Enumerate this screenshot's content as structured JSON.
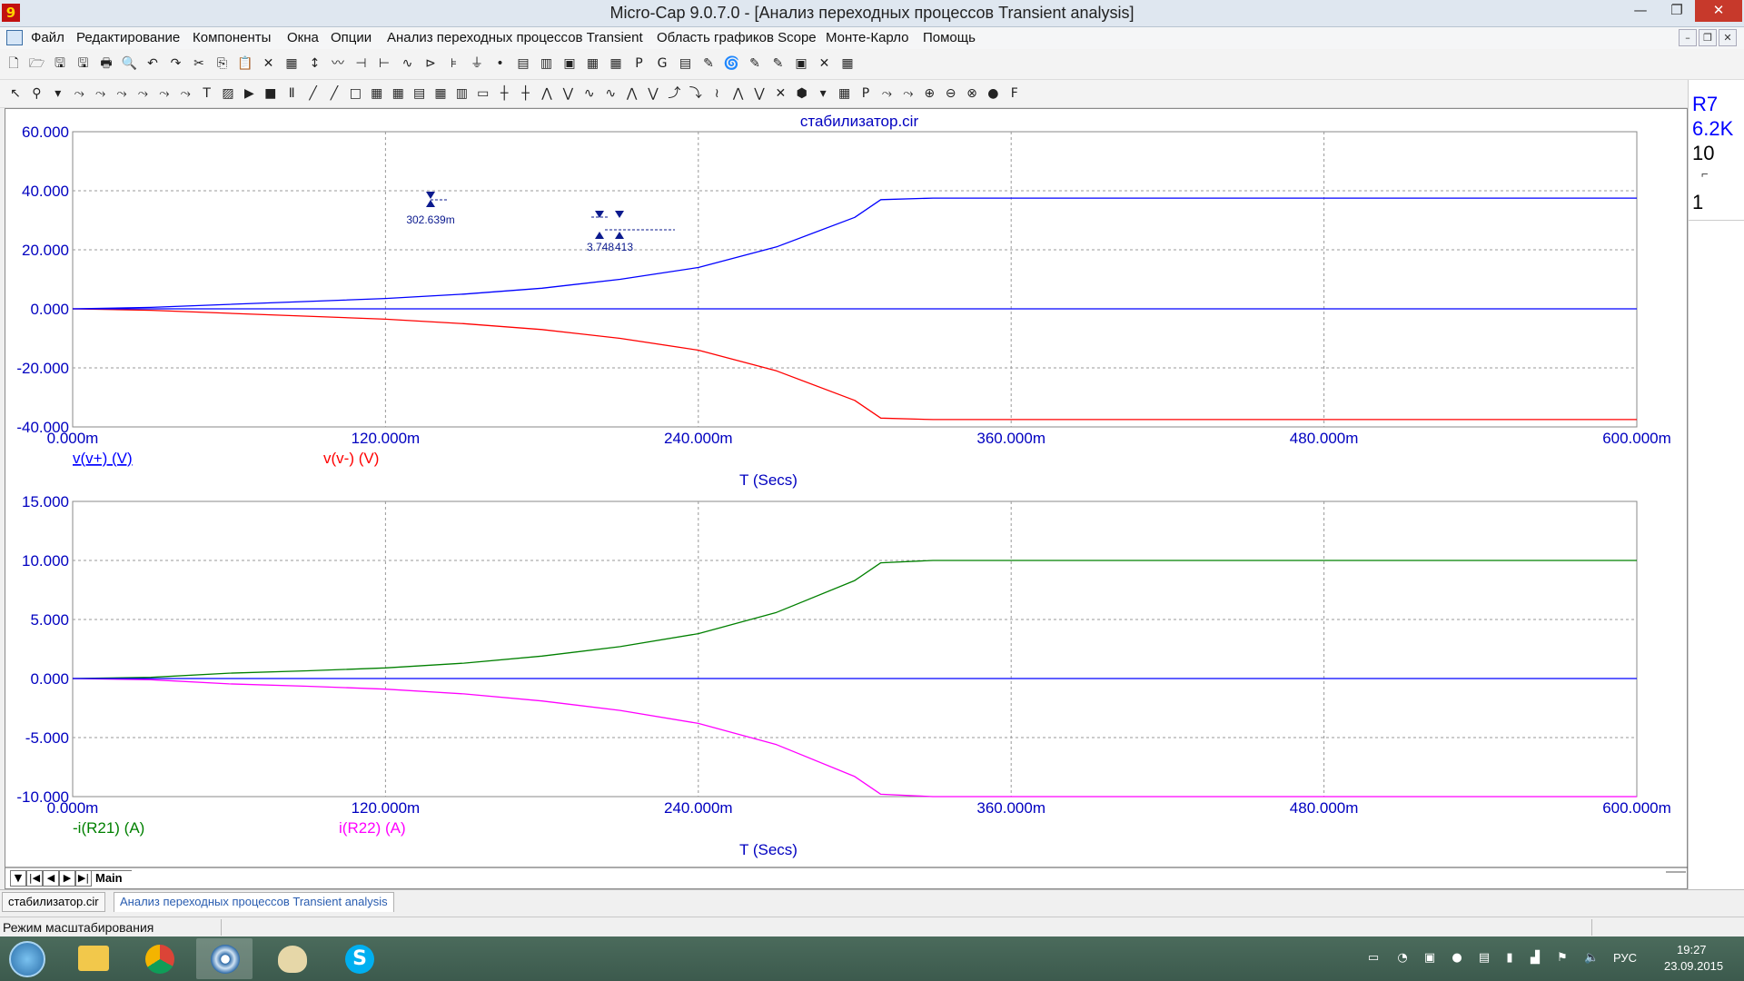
{
  "window": {
    "app_icon": "9",
    "title": "Micro-Cap 9.0.7.0 - [Анализ переходных процессов Transient analysis]",
    "minimize": "—",
    "maximize": "❐",
    "close": "✕"
  },
  "menu": {
    "items": [
      "Файл",
      "Редактирование",
      "Компоненты",
      "Окна",
      "Опции",
      "Анализ переходных процессов Transient",
      "Область графиков Scope",
      "Монте-Карло",
      "Помощь"
    ],
    "mdi_minimize": "–",
    "mdi_restore": "❐",
    "mdi_close": "✕"
  },
  "toolbar1": {
    "icons": [
      "new-icon",
      "open-icon",
      "save-icon",
      "save-all-icon",
      "print-icon",
      "print-preview-icon",
      "undo-icon",
      "redo-icon",
      "cut-icon",
      "copy-icon",
      "paste-icon",
      "delete-icon",
      "select-all-icon",
      "wire-icon",
      "diagonal-wire-icon",
      "resistor-icon",
      "capacitor-icon",
      "inductor-icon",
      "diode-icon",
      "battery-icon",
      "ground-icon",
      "node-icon",
      "tile-horizontal-icon",
      "tile-vertical-icon",
      "cascade-icon",
      "arrange-icon",
      "calculator-icon",
      "probe-p-icon",
      "probe-g-icon",
      "table-icon",
      "mark-icon",
      "scope-icon",
      "marker-icon",
      "pen-icon",
      "watch-icon",
      "x-icon",
      "grid-icon"
    ],
    "glyphs": [
      "🗋",
      "🗁",
      "🖫",
      "🖫",
      "🖶",
      "🔍",
      "↶",
      "↷",
      "✂",
      "⎘",
      "📋",
      "✕",
      "▦",
      "↕",
      "〰",
      "⊣",
      "⊢",
      "∿",
      "⊳",
      "⊧",
      "⏚",
      "•",
      "▤",
      "▥",
      "▣",
      "▦",
      "▦",
      "P",
      "G",
      "▤",
      "✎",
      "🌀",
      "✎",
      "✎",
      "▣",
      "✕",
      "▦"
    ]
  },
  "toolbar2": {
    "icons": [
      "select-arrow-icon",
      "zoom-icon",
      "dropdown-icon",
      "graph-icon",
      "graph2-icon",
      "graph3-icon",
      "graph4-icon",
      "graph5-icon",
      "graph6-icon",
      "text-icon",
      "properties-icon",
      "run-icon",
      "stop-icon",
      "pause-icon",
      "line-icon",
      "diagonal-icon",
      "box-icon",
      "grid-icon",
      "grid2-icon",
      "grid3-icon",
      "grid4-icon",
      "grid5-icon",
      "legend-icon",
      "cursor-icon",
      "cursor2-icon",
      "cursor3-icon",
      "scope-icon",
      "cursor-next-icon",
      "cursor-prev-icon",
      "peak-icon",
      "valley-icon",
      "high-icon",
      "low-icon",
      "inflection-icon",
      "top-icon",
      "bottom-icon",
      "slope-icon",
      "data-icon",
      "dropdown2-icon",
      "table-icon",
      "p-icon",
      "tag-icon",
      "tag2-icon",
      "zoom-in-icon",
      "zoom-out-icon",
      "zoom-fit-icon",
      "color-icon",
      "font-icon"
    ],
    "glyphs": [
      "↖",
      "⚲",
      "▾",
      "⤳",
      "⤳",
      "⤳",
      "⤳",
      "⤳",
      "⤳",
      "T",
      "▨",
      "▶",
      "■",
      "Ⅱ",
      "╱",
      "╱",
      "□",
      "▦",
      "▦",
      "▤",
      "▦",
      "▥",
      "▭",
      "┼",
      "┼",
      "⋀",
      "⋁",
      "∿",
      "∿",
      "⋀",
      "⋁",
      "⤴",
      "⤵",
      "≀",
      "⋀",
      "⋁",
      "✕",
      "⬢",
      "▾",
      "▦",
      "P",
      "⤳",
      "⤳",
      "⊕",
      "⊖",
      "⊗",
      "●",
      "F"
    ]
  },
  "side_panel": {
    "lines": [
      "R7",
      "6.2K",
      "10",
      "⌐",
      "1"
    ]
  },
  "plot": {
    "title": "стабилизатор.cir",
    "marker1": "302.639m",
    "marker2a": "3.748",
    "marker2b": "413",
    "colors": {
      "blue": "#0000ff",
      "red": "#ff0000",
      "green": "#008000",
      "magenta": "#ff00ff",
      "axis_text": "#0000c0"
    }
  },
  "chart_data": [
    {
      "type": "line",
      "xlabel": "T (Secs)",
      "x_ticks": [
        "0.000m",
        "120.000m",
        "240.000m",
        "360.000m",
        "480.000m",
        "600.000m"
      ],
      "y_ticks": [
        "60.000",
        "40.000",
        "20.000",
        "0.000",
        "-20.000",
        "-40.000"
      ],
      "xlim": [
        0,
        0.6
      ],
      "ylim": [
        -40,
        60
      ],
      "grid": true,
      "x": [
        0,
        0.03,
        0.06,
        0.09,
        0.12,
        0.15,
        0.18,
        0.21,
        0.24,
        0.27,
        0.3,
        0.31,
        0.33,
        0.36,
        0.4,
        0.45,
        0.5,
        0.55,
        0.6
      ],
      "series": [
        {
          "name": "v(v+) (V)",
          "color": "#0000ff",
          "values": [
            0,
            0.5,
            1.5,
            2.5,
            3.5,
            5,
            7,
            10,
            14,
            21,
            31,
            37,
            37.5,
            37.5,
            37.5,
            37.5,
            37.5,
            37.5,
            37.5
          ]
        },
        {
          "name": "v(v-) (V)",
          "color": "#ff0000",
          "values": [
            0,
            -0.5,
            -1.5,
            -2.5,
            -3.5,
            -5,
            -7,
            -10,
            -14,
            -21,
            -31,
            -37,
            -37.5,
            -37.5,
            -37.5,
            -37.5,
            -37.5,
            -37.5,
            -37.5
          ]
        },
        {
          "color": "#0000ff",
          "values": [
            0,
            0,
            0,
            0,
            0,
            0,
            0,
            0,
            0,
            0,
            0,
            0,
            0,
            0,
            0,
            0,
            0,
            0,
            0
          ]
        }
      ]
    },
    {
      "type": "line",
      "xlabel": "T (Secs)",
      "x_ticks": [
        "0.000m",
        "120.000m",
        "240.000m",
        "360.000m",
        "480.000m",
        "600.000m"
      ],
      "y_ticks": [
        "15.000",
        "10.000",
        "5.000",
        "0.000",
        "-5.000",
        "-10.000"
      ],
      "xlim": [
        0,
        0.6
      ],
      "ylim": [
        -10,
        15
      ],
      "grid": true,
      "x": [
        0,
        0.03,
        0.06,
        0.09,
        0.12,
        0.15,
        0.18,
        0.21,
        0.24,
        0.27,
        0.3,
        0.31,
        0.33,
        0.36,
        0.4,
        0.45,
        0.5,
        0.55,
        0.6
      ],
      "series": [
        {
          "name": "-i(R21) (A)",
          "color": "#008000",
          "values": [
            0,
            0.1,
            0.45,
            0.65,
            0.9,
            1.3,
            1.9,
            2.7,
            3.8,
            5.6,
            8.3,
            9.8,
            10,
            10,
            10,
            10,
            10,
            10,
            10
          ]
        },
        {
          "name": "i(R22) (A)",
          "color": "#ff00ff",
          "values": [
            0,
            -0.1,
            -0.45,
            -0.65,
            -0.9,
            -1.3,
            -1.9,
            -2.7,
            -3.8,
            -5.6,
            -8.3,
            -9.8,
            -10,
            -10,
            -10,
            -10,
            -10,
            -10,
            -10
          ]
        },
        {
          "color": "#0000ff",
          "values": [
            0,
            0,
            0,
            0,
            0,
            0,
            0,
            0,
            0,
            0,
            0,
            0,
            0,
            0,
            0,
            0,
            0,
            0,
            0
          ]
        }
      ]
    }
  ],
  "bottom_tabs": {
    "nav": [
      "▼",
      "|◀",
      "◀",
      "▶",
      "▶|"
    ],
    "main": "Main"
  },
  "mdi_tabs": [
    "стабилизатор.cir",
    "Анализ переходных процессов Transient analysis"
  ],
  "status": {
    "text": "Режим масштабирования"
  },
  "taskbar": {
    "lang": "РУС",
    "time": "19:27",
    "date": "23.09.2015"
  }
}
